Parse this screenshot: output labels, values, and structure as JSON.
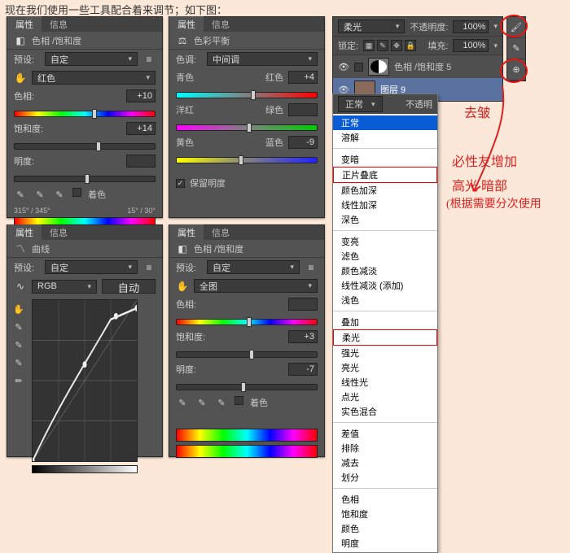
{
  "intro_text": "现在我们使用一些工具配合着来调节；如下图：",
  "tabs": {
    "properties": "属性",
    "info": "信息"
  },
  "panel1_huesat": {
    "title": "色相 /饱和度",
    "preset_label": "预设:",
    "preset_value": "自定",
    "range_value": "红色",
    "hue_label": "色相:",
    "hue_value": "+10",
    "sat_label": "饱和度:",
    "sat_value": "+14",
    "light_label": "明度:",
    "hand_label": "着色",
    "angle_text": "315° / 345°",
    "angle_text2": "15° / 30°"
  },
  "panel2_cbal": {
    "title": "色彩平衡",
    "tone_label": "色调:",
    "tone_value": "中间调",
    "cyan_label": "青色",
    "red_label": "红色",
    "cyan_red_value": "+4",
    "mag_label": "洋红",
    "green_label": "绿色",
    "mag_green_value": "",
    "yel_label": "黄色",
    "blue_label": "蓝色",
    "yel_blue_value": "-9",
    "preserve_label": "保留明度"
  },
  "panel3_curves": {
    "title": "曲线",
    "preset_label": "预设:",
    "preset_value": "自定",
    "channel_value": "RGB",
    "auto_label": "自动"
  },
  "panel4_huesat": {
    "title": "色相 /饱和度",
    "preset_label": "预设:",
    "preset_value": "自定",
    "range_value": "全图",
    "hue_label": "色相:",
    "hue_value": "",
    "sat_label": "饱和度:",
    "sat_value": "+3",
    "light_label": "明度:",
    "light_value": "-7",
    "hand_label": "着色"
  },
  "layers_panel": {
    "blend_mode": "柔光",
    "opacity_label": "不透明度:",
    "opacity_value": "100%",
    "lock_label": "锁定:",
    "fill_label": "填充:",
    "fill_value": "100%",
    "layer1_name": "色相 /饱和度 5",
    "layer2_name": "图层 9"
  },
  "dropdown": {
    "toplabel": "正常",
    "right_label": "不透明",
    "items_a": [
      "正常",
      "溶解"
    ],
    "items_b": [
      "变暗",
      "正片叠底",
      "颜色加深",
      "线性加深",
      "深色"
    ],
    "items_c": [
      "变亮",
      "滤色",
      "颜色减淡",
      "线性减淡 (添加)",
      "浅色"
    ],
    "items_d": [
      "叠加",
      "柔光",
      "强光",
      "亮光",
      "线性光",
      "点光",
      "实色混合"
    ],
    "items_e": [
      "差值",
      "排除",
      "减去",
      "划分"
    ],
    "items_f": [
      "色相",
      "饱和度",
      "颜色",
      "明度"
    ]
  },
  "annotations": {
    "a1": "去皱",
    "a2": "必性友增加",
    "a3": "高光 暗部",
    "a4": "(根据需要分次使用"
  }
}
